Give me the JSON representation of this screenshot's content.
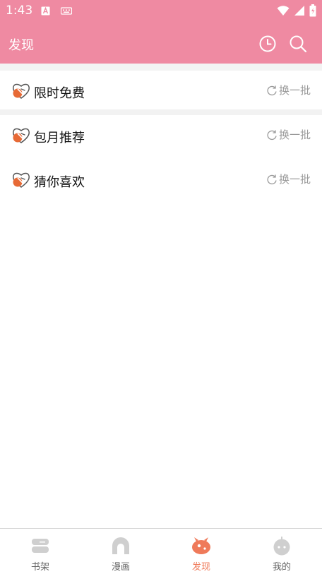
{
  "status_bar": {
    "time": "1:43"
  },
  "app_bar": {
    "title": "发现"
  },
  "sections": [
    {
      "title": "限时免费",
      "refresh_label": "换一批"
    },
    {
      "title": "包月推荐",
      "refresh_label": "换一批"
    },
    {
      "title": "猜你喜欢",
      "refresh_label": "换一批"
    }
  ],
  "bottom_nav": [
    {
      "label": "书架",
      "icon": "bookshelf-icon"
    },
    {
      "label": "漫画",
      "icon": "comic-icon"
    },
    {
      "label": "发现",
      "icon": "discover-icon",
      "active": true
    },
    {
      "label": "我的",
      "icon": "profile-icon"
    }
  ],
  "colors": {
    "primary": "#ef8aa2",
    "active_tab": "#ef7a5a",
    "inactive_icon": "#cfcfcf",
    "refresh_text": "#9a9a9a"
  }
}
